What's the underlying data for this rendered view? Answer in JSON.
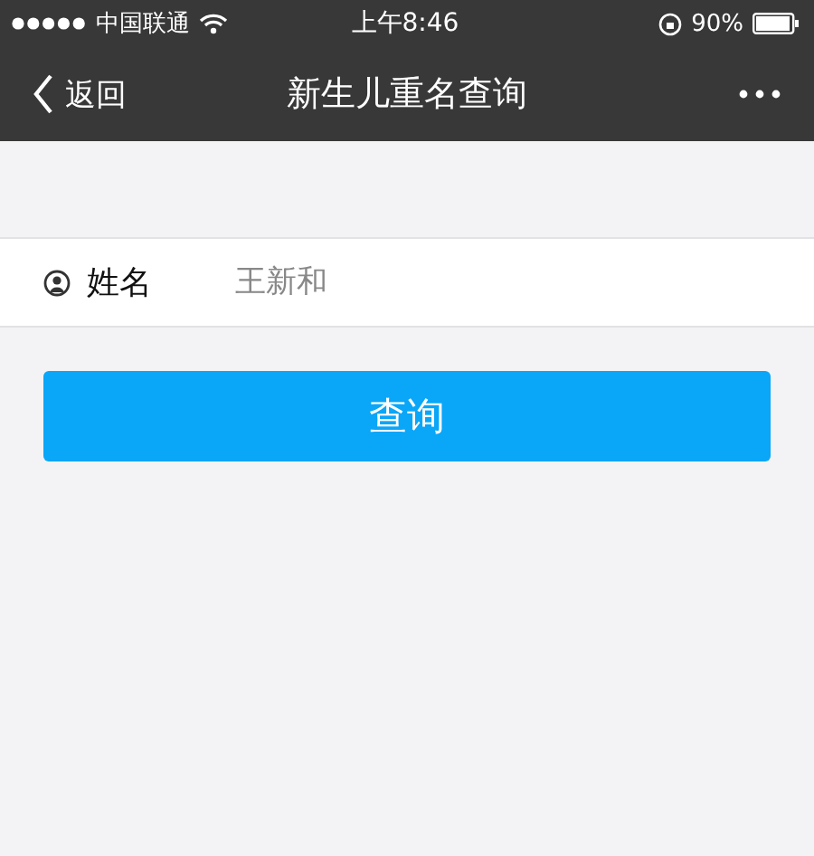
{
  "status_bar": {
    "carrier": "中国联通",
    "time": "上午8:46",
    "battery": "90%"
  },
  "nav_bar": {
    "back": "返回",
    "title": "新生儿重名查询"
  },
  "form": {
    "fields": [
      {
        "label": "姓名",
        "placeholder": "王新和"
      }
    ]
  },
  "buttons": [
    "查询"
  ]
}
